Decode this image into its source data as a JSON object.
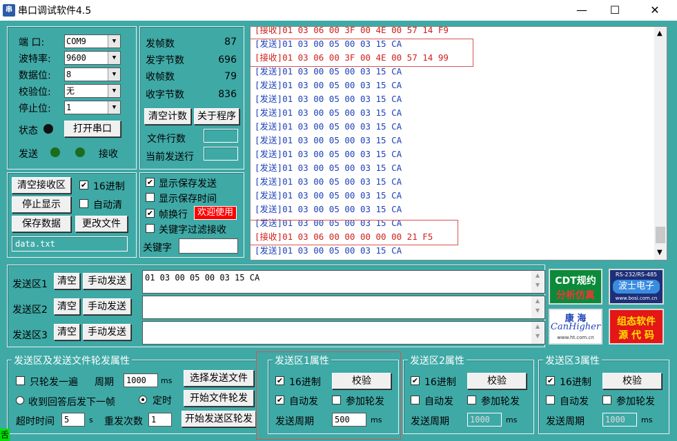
{
  "window": {
    "title": "串口调试软件4.5",
    "icon": "app-icon",
    "min_glyph": "—",
    "max_glyph": "☐",
    "close_glyph": "✕"
  },
  "serial": {
    "port_label": "端  口:",
    "port_value": "COM9",
    "baud_label": "波特率:",
    "baud_value": "9600",
    "databits_label": "数据位:",
    "databits_value": "8",
    "parity_label": "校验位:",
    "parity_value": "无",
    "stopbits_label": "停止位:",
    "stopbits_value": "1",
    "status_label": "状态",
    "open_button": "打开串口",
    "send_led_label": "发送",
    "recv_led_label": "接收"
  },
  "stats": {
    "tx_frames_label": "发帧数",
    "tx_frames": "87",
    "tx_bytes_label": "发字节数",
    "tx_bytes": "696",
    "rx_frames_label": "收帧数",
    "rx_frames": "79",
    "rx_bytes_label": "收字节数",
    "rx_bytes": "836",
    "clear_count_button": "清空计数",
    "about_button": "关于程序",
    "file_lines_label": "文件行数",
    "current_line_label": "当前发送行"
  },
  "recv_controls": {
    "clear_button": "清空接收区",
    "hex_label": "16进制",
    "hex_checked": true,
    "stop_button": "停止显示",
    "autoclear_label": "自动清",
    "autoclear_checked": false,
    "save_button": "保存数据",
    "change_file_button": "更改文件",
    "filename": "data.txt"
  },
  "display_opts": {
    "show_save_send": "显示保存发送",
    "show_save_send_checked": true,
    "show_save_time": "显示保存时间",
    "show_save_time_checked": false,
    "frame_newline": "帧换行",
    "frame_newline_checked": true,
    "welcome_badge": "欢迎使用",
    "keyword_filter": "关键字过滤接收",
    "keyword_filter_checked": false,
    "keyword_label": "关键字"
  },
  "recv_lines": [
    {
      "tag": "[接收]",
      "bytes": "01 03 06 00 3F 00 4E 00 57 14 F9",
      "kind": "rcv"
    },
    {
      "tag": "[发送]",
      "bytes": "01 03 00 05 00 03 15 CA",
      "kind": "send"
    },
    {
      "tag": "[接收]",
      "bytes": "01 03 06 00 3F 00 4E 00 57 14 99",
      "kind": "rcv"
    },
    {
      "tag": "[发送]",
      "bytes": "01 03 00 05 00 03 15 CA",
      "kind": "send"
    },
    {
      "tag": "[发送]",
      "bytes": "01 03 00 05 00 03 15 CA",
      "kind": "send"
    },
    {
      "tag": "[发送]",
      "bytes": "01 03 00 05 00 03 15 CA",
      "kind": "send"
    },
    {
      "tag": "[发送]",
      "bytes": "01 03 00 05 00 03 15 CA",
      "kind": "send"
    },
    {
      "tag": "[发送]",
      "bytes": "01 03 00 05 00 03 15 CA",
      "kind": "send"
    },
    {
      "tag": "[发送]",
      "bytes": "01 03 00 05 00 03 15 CA",
      "kind": "send"
    },
    {
      "tag": "[发送]",
      "bytes": "01 03 00 05 00 03 15 CA",
      "kind": "send"
    },
    {
      "tag": "[发送]",
      "bytes": "01 03 00 05 00 03 15 CA",
      "kind": "send"
    },
    {
      "tag": "[发送]",
      "bytes": "01 03 00 05 00 03 15 CA",
      "kind": "send"
    },
    {
      "tag": "[发送]",
      "bytes": "01 03 00 05 00 03 15 CA",
      "kind": "send"
    },
    {
      "tag": "[发送]",
      "bytes": "01 03 00 05 00 03 15 CA",
      "kind": "send"
    },
    {
      "tag": "[发送]",
      "bytes": "01 03 00 05 00 03 15 CA",
      "kind": "send"
    },
    {
      "tag": "[接收]",
      "bytes": "01 03 06 00 00 00 00 00 21 F5",
      "kind": "rcv"
    },
    {
      "tag": "[发送]",
      "bytes": "01 03 00 05 00 03 15 CA",
      "kind": "send"
    }
  ],
  "send_areas": [
    {
      "label": "发送区1",
      "clear": "清空",
      "send": "手动发送",
      "content": "01 03 00 05 00 03 15 CA"
    },
    {
      "label": "发送区2",
      "clear": "清空",
      "send": "手动发送",
      "content": ""
    },
    {
      "label": "发送区3",
      "clear": "清空",
      "send": "手动发送",
      "content": ""
    }
  ],
  "ads": {
    "cdt_line1": "CDT规约",
    "cdt_line2": "分析仿真",
    "bosi_top": "RS-232/RS-485",
    "bosi_mid": "波士电子",
    "bosi_url": "www.bosi.com.cn",
    "kanghai_cn": "康 海",
    "kanghai_en": "CanHigher",
    "kanghai_url": "www.ht.com.cn",
    "zutai_line1": "组态软件",
    "zutai_line2": "源 代 码"
  },
  "poll_props": {
    "title": "发送区及发送文件轮发属性",
    "only_once": "只轮发一遍",
    "only_once_checked": false,
    "period_label": "周期",
    "period_value": "1000",
    "ms": "ms",
    "select_file_button": "选择发送文件",
    "after_reply": "收到回答后发下一帧",
    "timed": "定时",
    "timed_selected": true,
    "start_file_poll_button": "开始文件轮发",
    "timeout_label": "超时时间",
    "timeout_value": "5",
    "s": "s",
    "resend_label": "重发次数",
    "resend_value": "1",
    "start_area_poll_button": "开始发送区轮发"
  },
  "area_props": [
    {
      "title": "发送区1属性",
      "hex": "16进制",
      "hex_checked": true,
      "check_button": "校验",
      "auto": "自动发",
      "auto_checked": true,
      "poll": "参加轮发",
      "poll_checked": false,
      "period_label": "发送周期",
      "period_value": "500",
      "ms": "ms",
      "enabled": true
    },
    {
      "title": "发送区2属性",
      "hex": "16进制",
      "hex_checked": true,
      "check_button": "校验",
      "auto": "自动发",
      "auto_checked": false,
      "poll": "参加轮发",
      "poll_checked": false,
      "period_label": "发送周期",
      "period_value": "1000",
      "ms": "ms",
      "enabled": false
    },
    {
      "title": "发送区3属性",
      "hex": "16进制",
      "hex_checked": true,
      "check_button": "校验",
      "auto": "自动发",
      "auto_checked": false,
      "poll": "参加轮发",
      "poll_checked": false,
      "period_label": "发送周期",
      "period_value": "1000",
      "ms": "ms",
      "enabled": false
    }
  ],
  "corner_mark": "舌",
  "colors": {
    "bg": "#3fa9a6",
    "send_text": "#1d41b8",
    "recv_text": "#d0201b",
    "highlight": "#d9534f",
    "led_off": "#1e6b1e"
  }
}
